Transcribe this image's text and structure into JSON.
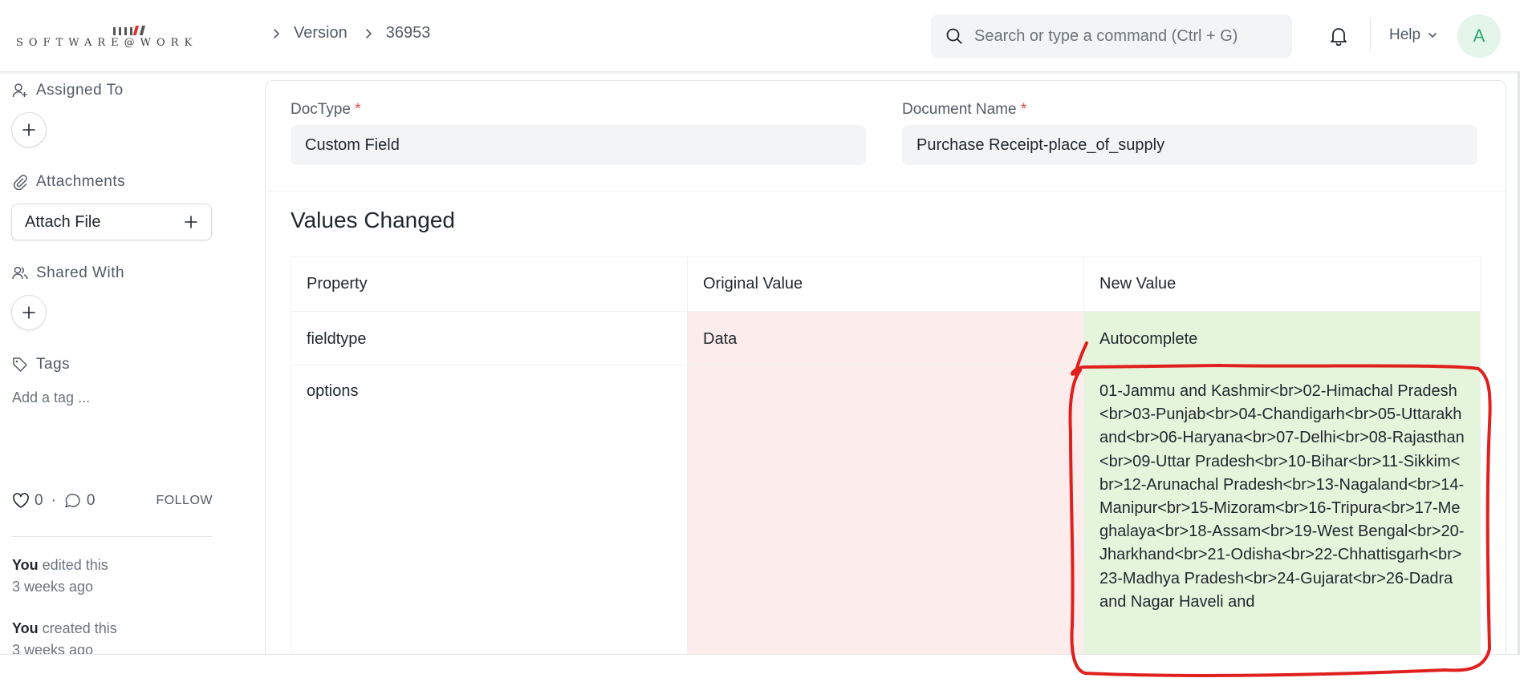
{
  "header": {
    "logo_text": "SOFTWARE@WORK",
    "breadcrumbs": [
      "Version",
      "36953"
    ],
    "search": {
      "placeholder": "Search or type a command (Ctrl + G)"
    },
    "help_label": "Help",
    "avatar_initial": "A"
  },
  "sidebar": {
    "assigned_to_label": "Assigned To",
    "attachments_label": "Attachments",
    "attach_file_label": "Attach File",
    "shared_with_label": "Shared With",
    "tags_label": "Tags",
    "add_tag_label": "Add a tag ...",
    "likes_count": "0",
    "comments_count": "0",
    "dot": "·",
    "follow_label": "FOLLOW",
    "activity": [
      {
        "user": "You",
        "action": " edited this",
        "time": "3 weeks ago"
      },
      {
        "user": "You",
        "action": " created this",
        "time": "3 weeks ago"
      }
    ]
  },
  "form": {
    "doctype_label": "DocType",
    "doctype_value": "Custom Field",
    "docname_label": "Document Name",
    "docname_value": "Purchase Receipt-place_of_supply",
    "required_mark": "*"
  },
  "values_changed": {
    "title": "Values Changed",
    "columns": [
      "Property",
      "Original Value",
      "New Value"
    ],
    "rows": [
      {
        "property": "fieldtype",
        "original": "Data",
        "new": "Autocomplete"
      },
      {
        "property": "options",
        "original": "",
        "new": "01-Jammu and Kashmir<br>02-Himachal Pradesh<br>03-Punjab<br>04-Chandigarh<br>05-Uttarakhand<br>06-Haryana<br>07-Delhi<br>08-Rajasthan<br>09-Uttar Pradesh<br>10-Bihar<br>11-Sikkim<br>12-Arunachal Pradesh<br>13-Nagaland<br>14-Manipur<br>15-Mizoram<br>16-Tripura<br>17-Meghalaya<br>18-Assam<br>19-West Bengal<br>20-Jharkhand<br>21-Odisha<br>22-Chhattisgarh<br>23-Madhya Pradesh<br>24-Gujarat<br>26-Dadra and Nagar Haveli and"
      }
    ]
  },
  "colors": {
    "original_bg": "#fdecec",
    "new_bg": "#e5f5dc",
    "annotation": "#e0201d",
    "avatar_fg": "#30a66d"
  }
}
